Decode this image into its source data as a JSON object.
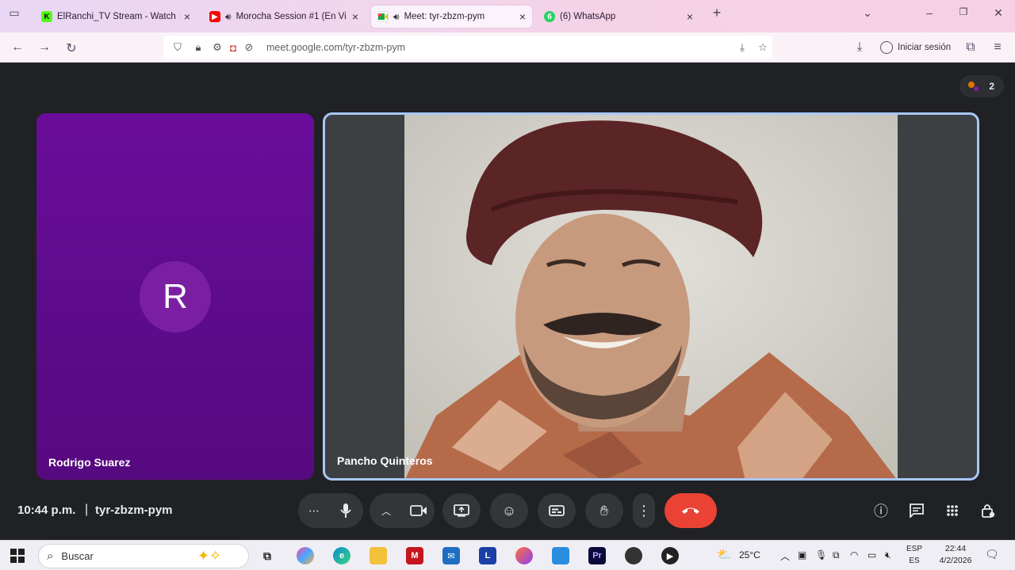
{
  "browser": {
    "tabs": [
      {
        "title": "ElRanchi_TV Stream - Watch Li",
        "favicon_letter": "K",
        "favicon_color": "#53fc18"
      },
      {
        "title": "Morocha Session #1 (En Vi",
        "favicon_color": "#ff0000"
      },
      {
        "title": "Meet: tyr-zbzm-pym",
        "favicon_color": "#00897b"
      },
      {
        "title": "(6) WhatsApp",
        "favicon_letter": "6",
        "favicon_color": "#25d366"
      }
    ],
    "url": "meet.google.com/tyr-zbzm-pym",
    "signin_label": "Iniciar sesión"
  },
  "meet": {
    "participant_count": "2",
    "participants": [
      {
        "name": "Rodrigo Suarez",
        "avatar_letter": "R",
        "tile_color": "#5f0a8f"
      },
      {
        "name": "Pancho Quinteros"
      }
    ],
    "time": "10:44 p.m.",
    "separator": "|",
    "meeting_code": "tyr-zbzm-pym",
    "end_call_color": "#ea4335"
  },
  "taskbar": {
    "search_placeholder": "Buscar",
    "weather": "25°C",
    "language_line1": "ESP",
    "language_line2": "ES",
    "time": "22:44",
    "date": "4/2/2026"
  }
}
